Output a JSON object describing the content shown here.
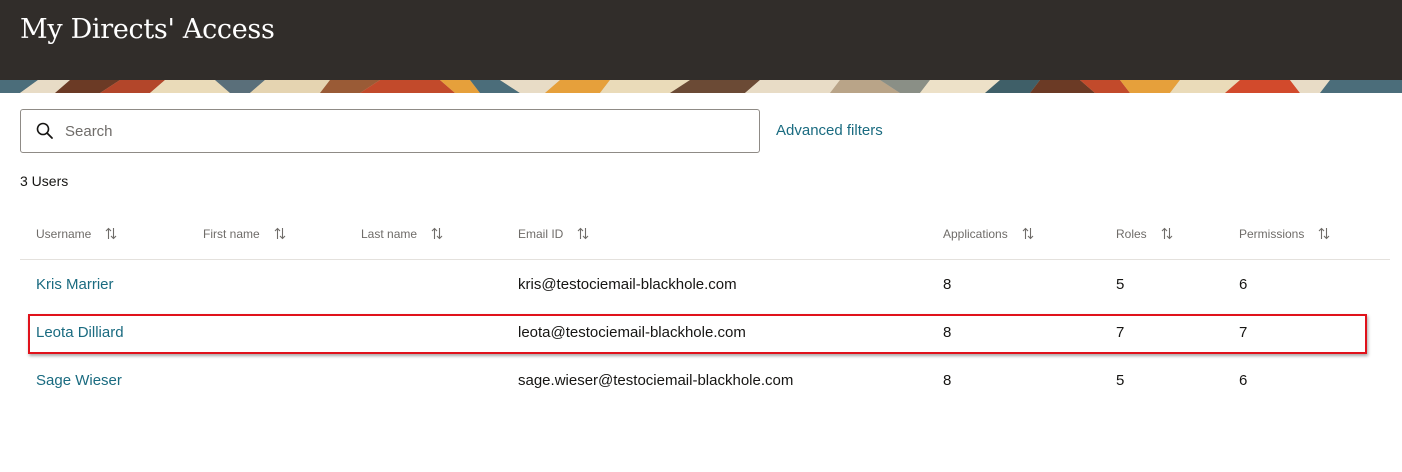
{
  "page": {
    "title": "My Directs' Access"
  },
  "search": {
    "placeholder": "Search",
    "value": ""
  },
  "filters": {
    "advanced_label": "Advanced filters"
  },
  "summary": {
    "count_label": "3 Users"
  },
  "table": {
    "columns": [
      {
        "label": "Username"
      },
      {
        "label": "First name"
      },
      {
        "label": "Last name"
      },
      {
        "label": "Email ID"
      },
      {
        "label": "Applications"
      },
      {
        "label": "Roles"
      },
      {
        "label": "Permissions"
      }
    ],
    "rows": [
      {
        "username": "Kris Marrier",
        "first_name": "",
        "last_name": "",
        "email": "kris@testociemail-blackhole.com",
        "applications": "8",
        "roles": "5",
        "permissions": "6"
      },
      {
        "username": "Leota Dilliard",
        "first_name": "",
        "last_name": "",
        "email": "leota@testociemail-blackhole.com",
        "applications": "8",
        "roles": "7",
        "permissions": "7",
        "highlighted": true
      },
      {
        "username": "Sage Wieser",
        "first_name": "",
        "last_name": "",
        "email": "sage.wieser@testociemail-blackhole.com",
        "applications": "8",
        "roles": "5",
        "permissions": "6"
      }
    ]
  },
  "colors": {
    "header_bg": "#312d2a",
    "link": "#1a6b80",
    "highlight": "#e0121b",
    "muted_text": "#6f6c69"
  },
  "icons": {
    "search": "search-icon",
    "sort": "sort-arrows-icon"
  }
}
